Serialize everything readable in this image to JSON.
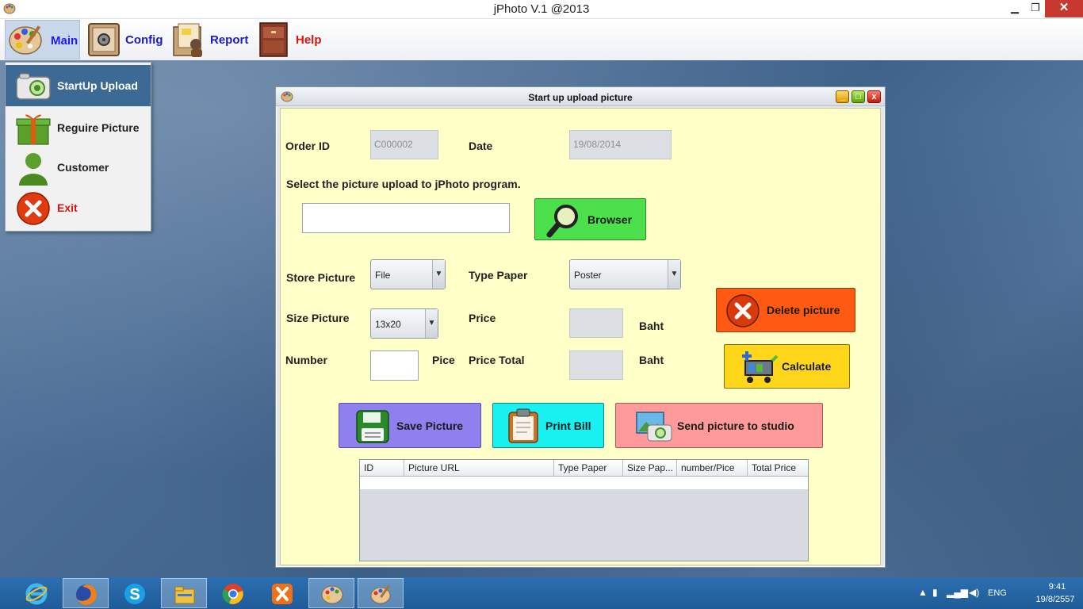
{
  "window": {
    "title": "jPhoto V.1 @2013",
    "min_glyph": "▁",
    "max_glyph": "❐",
    "close_glyph": "✕"
  },
  "menubar": {
    "items": [
      {
        "label": "Main",
        "icon": "palette-icon",
        "color": "#1a1aff"
      },
      {
        "label": "Config",
        "icon": "safe-icon",
        "color": "#1a1acc"
      },
      {
        "label": "Report",
        "icon": "folder-report-icon",
        "color": "#1a1acc"
      },
      {
        "label": "Help",
        "icon": "cabinet-icon",
        "color": "#e01010"
      }
    ]
  },
  "dropdown": {
    "items": [
      {
        "label": "StartUp Upload",
        "icon": "camera-icon"
      },
      {
        "label": "Reguire Picture",
        "icon": "gift-icon"
      },
      {
        "label": "Customer",
        "icon": "user-icon"
      },
      {
        "label": "Exit",
        "icon": "exit-icon"
      }
    ]
  },
  "frame": {
    "title": "Start up upload picture",
    "min_glyph": "_",
    "max_glyph": "□",
    "close_glyph": "x"
  },
  "form": {
    "order_id_label": "Order ID",
    "order_id_value": "C000002",
    "date_label": "Date",
    "date_value": "19/08/2014",
    "select_prompt": "Select the picture upload to jPhoto program.",
    "file_path_value": "",
    "store_picture_label": "Store Picture",
    "store_picture_value": "File",
    "type_paper_label": "Type Paper",
    "type_paper_value": "Poster",
    "size_picture_label": "Size Picture",
    "size_picture_value": "13x20",
    "price_label": "Price",
    "price_value": "",
    "price_unit": "Baht",
    "number_label": "Number",
    "number_value": "",
    "number_unit": "Pice",
    "price_total_label": "Price Total",
    "price_total_value": "",
    "price_total_unit": "Baht",
    "combo_arrow": "▼"
  },
  "buttons": {
    "browser": "Browser",
    "delete": "Delete picture",
    "calculate": "Calculate",
    "save": "Save Picture",
    "print": "Print Bill",
    "send": "Send picture to studio"
  },
  "table": {
    "columns": [
      "ID",
      "Picture URL",
      "Type Paper",
      "Size Pap...",
      "number/Pice",
      "Total Price"
    ],
    "rows": []
  },
  "taskbar": {
    "apps": [
      {
        "name": "internet-explorer-icon",
        "active": false
      },
      {
        "name": "firefox-icon",
        "active": true
      },
      {
        "name": "skype-icon",
        "active": false
      },
      {
        "name": "file-explorer-icon",
        "active": true
      },
      {
        "name": "chrome-icon",
        "active": false
      },
      {
        "name": "xampp-icon",
        "active": false
      },
      {
        "name": "jphoto-icon",
        "active": true
      },
      {
        "name": "paint-palette-icon",
        "active": true
      }
    ],
    "tray": {
      "lang": "ENG",
      "time": "9:41",
      "date": "19/8/2557"
    }
  },
  "colors": {
    "panel_bg": "#ffffc8",
    "browser_btn": "#4ce04c",
    "delete_btn": "#ff5a14",
    "calc_btn": "#ffd61a",
    "save_btn": "#8f80f0",
    "print_btn": "#19f0f0",
    "send_btn": "#ff9a9a"
  }
}
